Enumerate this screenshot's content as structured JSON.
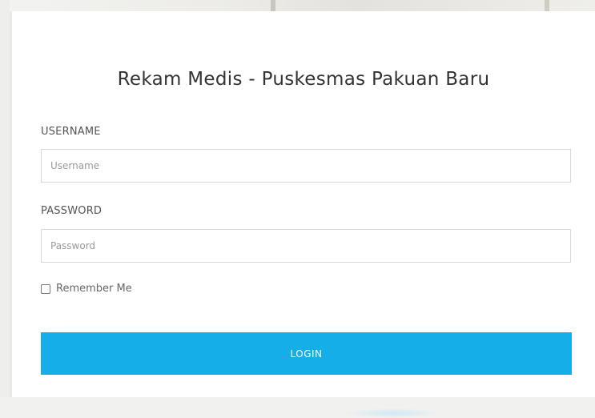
{
  "title": "Rekam Medis - Puskesmas Pakuan Baru",
  "form": {
    "username_label": "USERNAME",
    "username_placeholder": "Username",
    "username_value": "",
    "password_label": "PASSWORD",
    "password_placeholder": "Password",
    "password_value": "",
    "remember_label": "Remember Me",
    "remember_checked": false,
    "login_label": "LOGIN"
  },
  "colors": {
    "accent": "#16aee9",
    "background": "#e9e9e9",
    "card": "#ffffff"
  }
}
